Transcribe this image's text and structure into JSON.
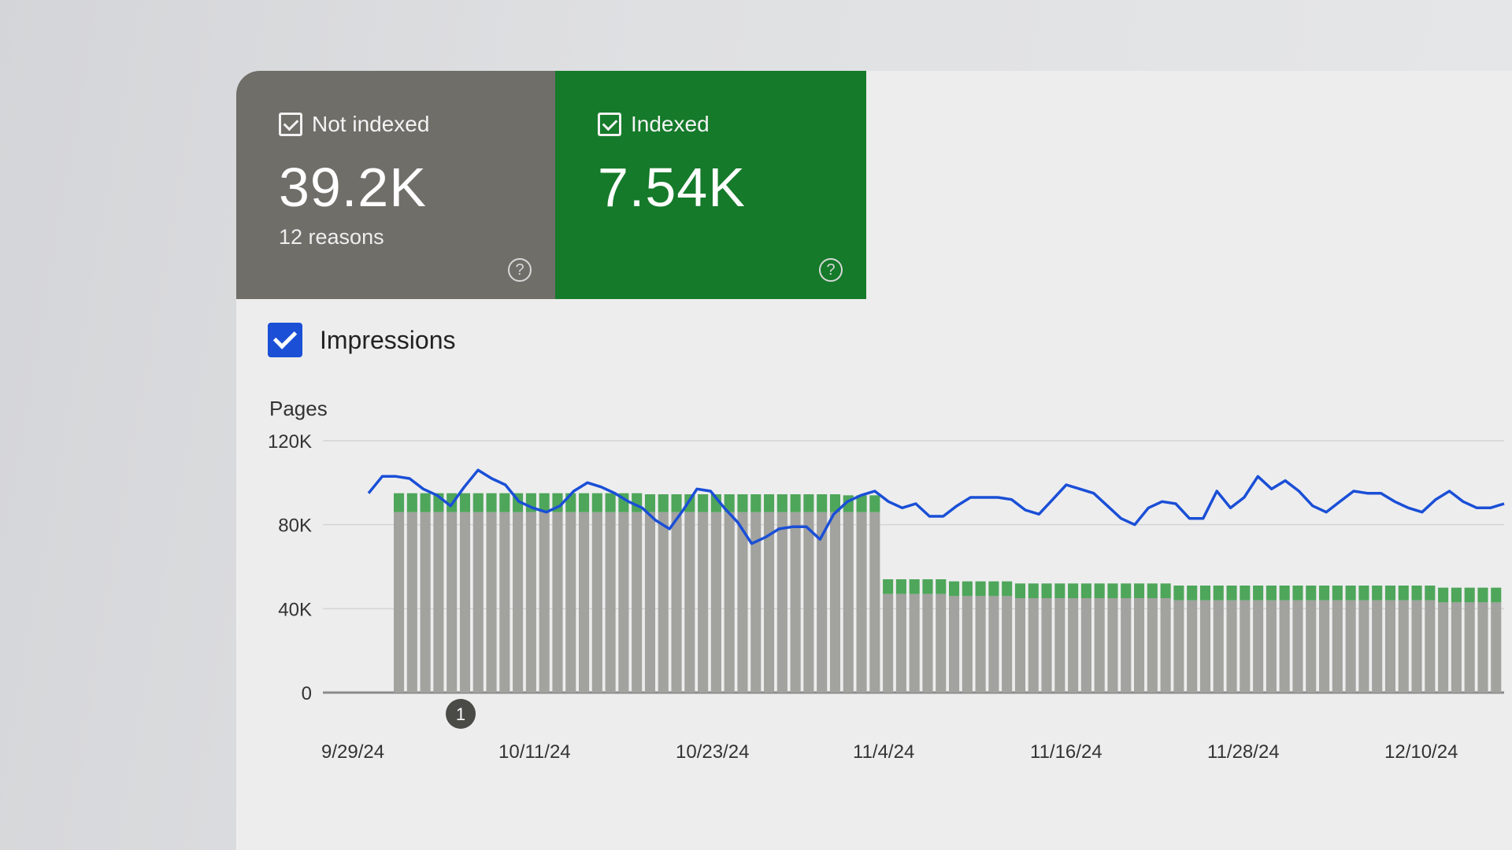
{
  "cards": [
    {
      "label": "Not indexed",
      "value": "39.2K",
      "sub": "12 reasons",
      "help": "?"
    },
    {
      "label": "Indexed",
      "value": "7.54K",
      "sub": "",
      "help": "?"
    }
  ],
  "legend": {
    "label": "Impressions",
    "checked": true
  },
  "annotation": {
    "label": "1"
  },
  "colors": {
    "not_indexed": "#a2a29f",
    "indexed": "#4ea65a",
    "impressions": "#1a4fd6",
    "card_not_indexed": "#6f6e69",
    "card_indexed": "#157a2a"
  },
  "chart_data": {
    "type": "bar",
    "ylabel": "Pages",
    "ylim": [
      0,
      120000
    ],
    "yticks": [
      0,
      40000,
      80000,
      120000
    ],
    "ytick_labels": [
      "0",
      "40K",
      "80K",
      "120K"
    ],
    "xtick_labels": [
      "9/29/24",
      "10/11/24",
      "10/23/24",
      "11/4/24",
      "11/16/24",
      "11/28/24",
      "12/10/24"
    ],
    "stacked": true,
    "series": [
      {
        "name": "Not indexed",
        "values": [
          86000,
          86000,
          86000,
          86000,
          86000,
          86000,
          86000,
          86000,
          86000,
          86000,
          86000,
          86000,
          86000,
          86000,
          86000,
          86000,
          86000,
          86000,
          86000,
          86000,
          86000,
          86000,
          86000,
          86000,
          86000,
          86000,
          86000,
          86000,
          86000,
          86000,
          86000,
          86000,
          86000,
          86000,
          86000,
          86000,
          86000,
          47000,
          47000,
          47000,
          47000,
          47000,
          46000,
          46000,
          46000,
          46000,
          46000,
          45000,
          45000,
          45000,
          45000,
          45000,
          45000,
          45000,
          45000,
          45000,
          45000,
          45000,
          45000,
          44000,
          44000,
          44000,
          44000,
          44000,
          44000,
          44000,
          44000,
          44000,
          44000,
          44000,
          44000,
          44000,
          44000,
          44000,
          44000,
          44000,
          44000,
          44000,
          44000,
          43000,
          43000,
          43000,
          43000,
          43000
        ]
      },
      {
        "name": "Indexed",
        "values": [
          9000,
          9000,
          9000,
          9000,
          9000,
          9000,
          9000,
          9000,
          9000,
          9000,
          9000,
          9000,
          9000,
          9000,
          9000,
          9000,
          9000,
          9000,
          9000,
          8500,
          8500,
          8500,
          8500,
          8500,
          8500,
          8500,
          8500,
          8500,
          8500,
          8500,
          8500,
          8500,
          8500,
          8500,
          8000,
          8000,
          8000,
          7000,
          7000,
          7000,
          7000,
          7000,
          7000,
          7000,
          7000,
          7000,
          7000,
          7000,
          7000,
          7000,
          7000,
          7000,
          7000,
          7000,
          7000,
          7000,
          7000,
          7000,
          7000,
          7000,
          7000,
          7000,
          7000,
          7000,
          7000,
          7000,
          7000,
          7000,
          7000,
          7000,
          7000,
          7000,
          7000,
          7000,
          7000,
          7000,
          7000,
          7000,
          7000,
          7000,
          7000,
          7000,
          7000,
          7000
        ]
      },
      {
        "name": "Impressions",
        "type": "line",
        "values": [
          95000,
          103000,
          103000,
          102000,
          97000,
          94000,
          89000,
          98000,
          106000,
          102000,
          99000,
          91000,
          88000,
          86000,
          89000,
          96000,
          100000,
          98000,
          95000,
          91000,
          88000,
          82000,
          78000,
          87000,
          97000,
          96000,
          88000,
          81000,
          71000,
          74000,
          78000,
          79000,
          79000,
          73000,
          85000,
          91000,
          94000,
          96000,
          91000,
          88000,
          90000,
          84000,
          84000,
          89000,
          93000,
          93000,
          93000,
          92000,
          87000,
          85000,
          92000,
          99000,
          97000,
          95000,
          89000,
          83000,
          80000,
          88000,
          91000,
          90000,
          83000,
          83000,
          96000,
          88000,
          93000,
          103000,
          97000,
          101000,
          96000,
          89000,
          86000,
          91000,
          96000,
          95000,
          95000,
          91000,
          88000,
          86000,
          92000,
          96000,
          91000,
          88000,
          88000,
          90000
        ]
      }
    ]
  }
}
